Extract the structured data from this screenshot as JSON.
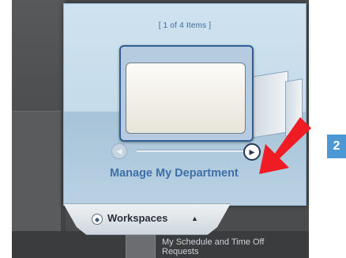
{
  "carousel": {
    "counter": "[ 1 of 4 Items ]",
    "current_item_title": "Manage My Department"
  },
  "workspaces": {
    "label": "Workspaces",
    "caret": "▲"
  },
  "background_panel": {
    "item_text": "My Schedule and Time Off Requests"
  },
  "annotation": {
    "step_number": "2",
    "arrow_color": "#ef1c24"
  },
  "colors": {
    "accent_text": "#3f6fa8",
    "step_badge": "#4b98d4"
  }
}
